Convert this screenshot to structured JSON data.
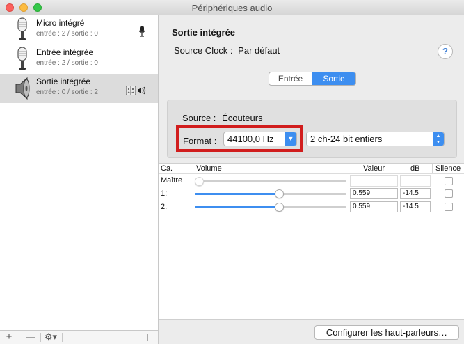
{
  "window": {
    "title": "Périphériques audio"
  },
  "devices": [
    {
      "name": "Micro intégré",
      "sub": "entrée : 2 / sortie : 0",
      "icon": "microphone-icon",
      "badge": "microphone-small-icon",
      "selected": false
    },
    {
      "name": "Entrée intégrée",
      "sub": "entrée : 2 / sortie : 0",
      "icon": "microphone-icon",
      "badge": "",
      "selected": false
    },
    {
      "name": "Sortie intégrée",
      "sub": "entrée : 0 / sortie : 2",
      "icon": "speaker-icon",
      "badge": "finder-speaker-icon",
      "selected": true
    }
  ],
  "bottombar": {
    "add": "+",
    "remove": "—",
    "gear": "⚙▾"
  },
  "detail": {
    "title": "Sortie intégrée",
    "clock_label": "Source Clock :",
    "clock_value": "Par défaut",
    "help": "?",
    "tabs": {
      "input": "Entrée",
      "output": "Sortie",
      "selected": "output"
    },
    "source_label": "Source :",
    "source_value": "Écouteurs",
    "format_label": "Format :",
    "sample_rate": "44100,0 Hz",
    "bit_format": "2 ch-24 bit entiers"
  },
  "table": {
    "headers": {
      "channel": "Ca.",
      "volume": "Volume",
      "value": "Valeur",
      "db": "dB",
      "mute": "Silence"
    },
    "rows": [
      {
        "label": "Maître",
        "volume": 0,
        "value": "",
        "db": "",
        "enabled": false,
        "mute": false
      },
      {
        "label": "1:",
        "volume": 0.559,
        "value": "0.559",
        "db": "-14.5",
        "enabled": true,
        "mute": false
      },
      {
        "label": "2:",
        "volume": 0.559,
        "value": "0.559",
        "db": "-14.5",
        "enabled": true,
        "mute": false
      }
    ]
  },
  "configure_button": "Configurer les haut-parleurs…",
  "colors": {
    "accent": "#3d8ef0",
    "highlight_border": "#d11d1d"
  }
}
